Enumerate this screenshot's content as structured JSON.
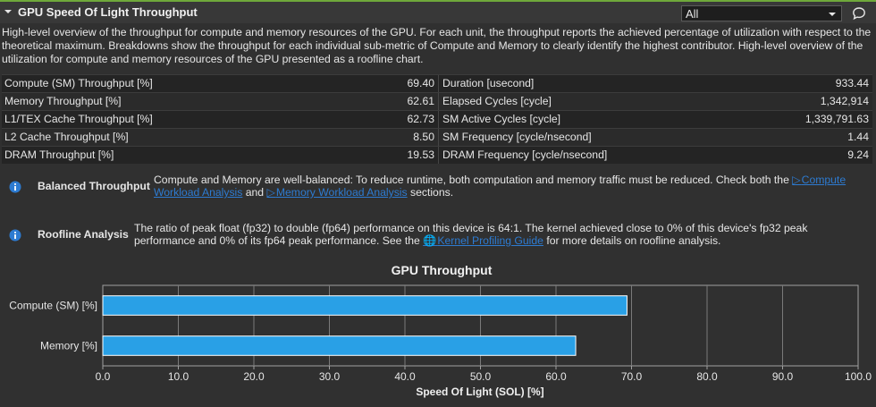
{
  "header": {
    "title": "GPU Speed Of Light Throughput"
  },
  "filter": {
    "selected": "All"
  },
  "description": "High-level overview of the throughput for compute and memory resources of the GPU. For each unit, the throughput reports the achieved percentage of utilization with respect to the theoretical maximum. Breakdowns show the throughput for each individual sub-metric of Compute and Memory to clearly identify the highest contributor. High-level overview of the utilization for compute and memory resources of the GPU presented as a roofline chart.",
  "metrics": [
    {
      "left_name": "Compute (SM) Throughput [%]",
      "left_value": "69.40",
      "right_name": "Duration [usecond]",
      "right_value": "933.44"
    },
    {
      "left_name": "Memory Throughput [%]",
      "left_value": "62.61",
      "right_name": "Elapsed Cycles [cycle]",
      "right_value": "1,342,914"
    },
    {
      "left_name": "L1/TEX Cache Throughput [%]",
      "left_value": "62.73",
      "right_name": "SM Active Cycles [cycle]",
      "right_value": "1,339,791.63"
    },
    {
      "left_name": "L2 Cache Throughput [%]",
      "left_value": "8.50",
      "right_name": "SM Frequency [cycle/nsecond]",
      "right_value": "1.44"
    },
    {
      "left_name": "DRAM Throughput [%]",
      "left_value": "19.53",
      "right_name": "DRAM Frequency [cycle/nsecond]",
      "right_value": "9.24"
    }
  ],
  "rules": {
    "balanced": {
      "name": "Balanced Throughput",
      "text1": "Compute and Memory are well-balanced: To reduce runtime, both computation and memory traffic must be reduced. Check both the ",
      "link1": "Compute",
      "link1b": "Workload Analysis",
      "text2": " and ",
      "link2": "Memory Workload Analysis",
      "text3": " sections."
    },
    "roofline": {
      "name": "Roofline Analysis",
      "text1": "The ratio of peak float (fp32) to double (fp64) performance on this device is 64:1. The kernel achieved close to 0% of this device's fp32 peak",
      "text2": "performance and 0% of its fp64 peak performance. See the ",
      "link": "Kernel Profiling Guide",
      "text3": " for more details on roofline analysis."
    }
  },
  "chart_data": {
    "type": "bar",
    "orientation": "horizontal",
    "title": "GPU Throughput",
    "xlabel": "Speed Of Light (SOL) [%]",
    "ylabel": "",
    "categories": [
      "Compute (SM) [%]",
      "Memory [%]"
    ],
    "values": [
      69.4,
      62.61
    ],
    "xlim": [
      0,
      100
    ],
    "xticks": [
      "0.0",
      "10.0",
      "20.0",
      "30.0",
      "40.0",
      "50.0",
      "60.0",
      "70.0",
      "80.0",
      "90.0",
      "100.0"
    ],
    "grid": true,
    "bar_color": "#29a0e6"
  }
}
